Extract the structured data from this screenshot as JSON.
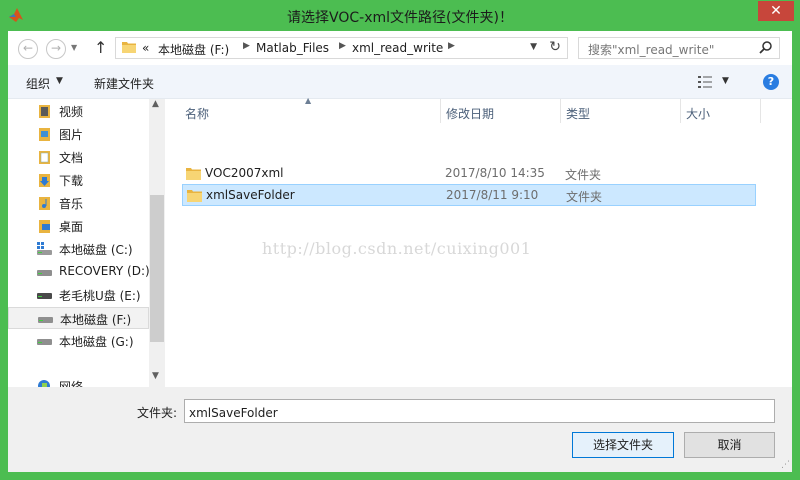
{
  "window": {
    "title": "请选择VOC-xml文件路径(文件夹)！",
    "close_glyph": "✕"
  },
  "nav": {
    "back_glyph": "←",
    "forward_glyph": "→",
    "up_glyph": "↑",
    "chevron": "«",
    "breadcrumb": [
      "本地磁盘 (F:)",
      "Matlab_Files",
      "xml_read_write"
    ],
    "refresh_glyph": "↻",
    "search_placeholder": "搜索\"xml_read_write\""
  },
  "toolbar": {
    "organize_label": "组织",
    "new_folder_label": "新建文件夹",
    "help_glyph": "?"
  },
  "sidebar": {
    "items": [
      {
        "label": "视频",
        "icon": "videos-folder-icon"
      },
      {
        "label": "图片",
        "icon": "pictures-folder-icon"
      },
      {
        "label": "文档",
        "icon": "documents-folder-icon"
      },
      {
        "label": "下载",
        "icon": "downloads-folder-icon"
      },
      {
        "label": "音乐",
        "icon": "music-folder-icon"
      },
      {
        "label": "桌面",
        "icon": "desktop-folder-icon"
      },
      {
        "label": "本地磁盘 (C:)",
        "icon": "system-drive-icon"
      },
      {
        "label": "RECOVERY (D:)",
        "icon": "drive-icon"
      },
      {
        "label": "老毛桃U盘 (E:)",
        "icon": "usb-drive-icon"
      },
      {
        "label": "本地磁盘 (F:)",
        "icon": "drive-icon",
        "selected": true
      },
      {
        "label": "本地磁盘 (G:)",
        "icon": "drive-icon"
      },
      {
        "label": "网络",
        "icon": "network-icon"
      }
    ]
  },
  "filelist": {
    "columns": [
      "名称",
      "修改日期",
      "类型",
      "大小"
    ],
    "rows": [
      {
        "name": "VOC2007xml",
        "date": "2017/8/10 14:35",
        "type": "文件夹",
        "selected": false
      },
      {
        "name": "xmlSaveFolder",
        "date": "2017/8/11 9:10",
        "type": "文件夹",
        "selected": true
      }
    ],
    "watermark": "http://blog.csdn.net/cuixing001"
  },
  "bottom": {
    "folder_label": "文件夹:",
    "folder_value": "xmlSaveFolder",
    "select_button": "选择文件夹",
    "cancel_button": "取消"
  },
  "colors": {
    "frame": "#4cbd51",
    "close": "#c7463b",
    "selection": "#cce8ff",
    "accent": "#0078d7"
  }
}
